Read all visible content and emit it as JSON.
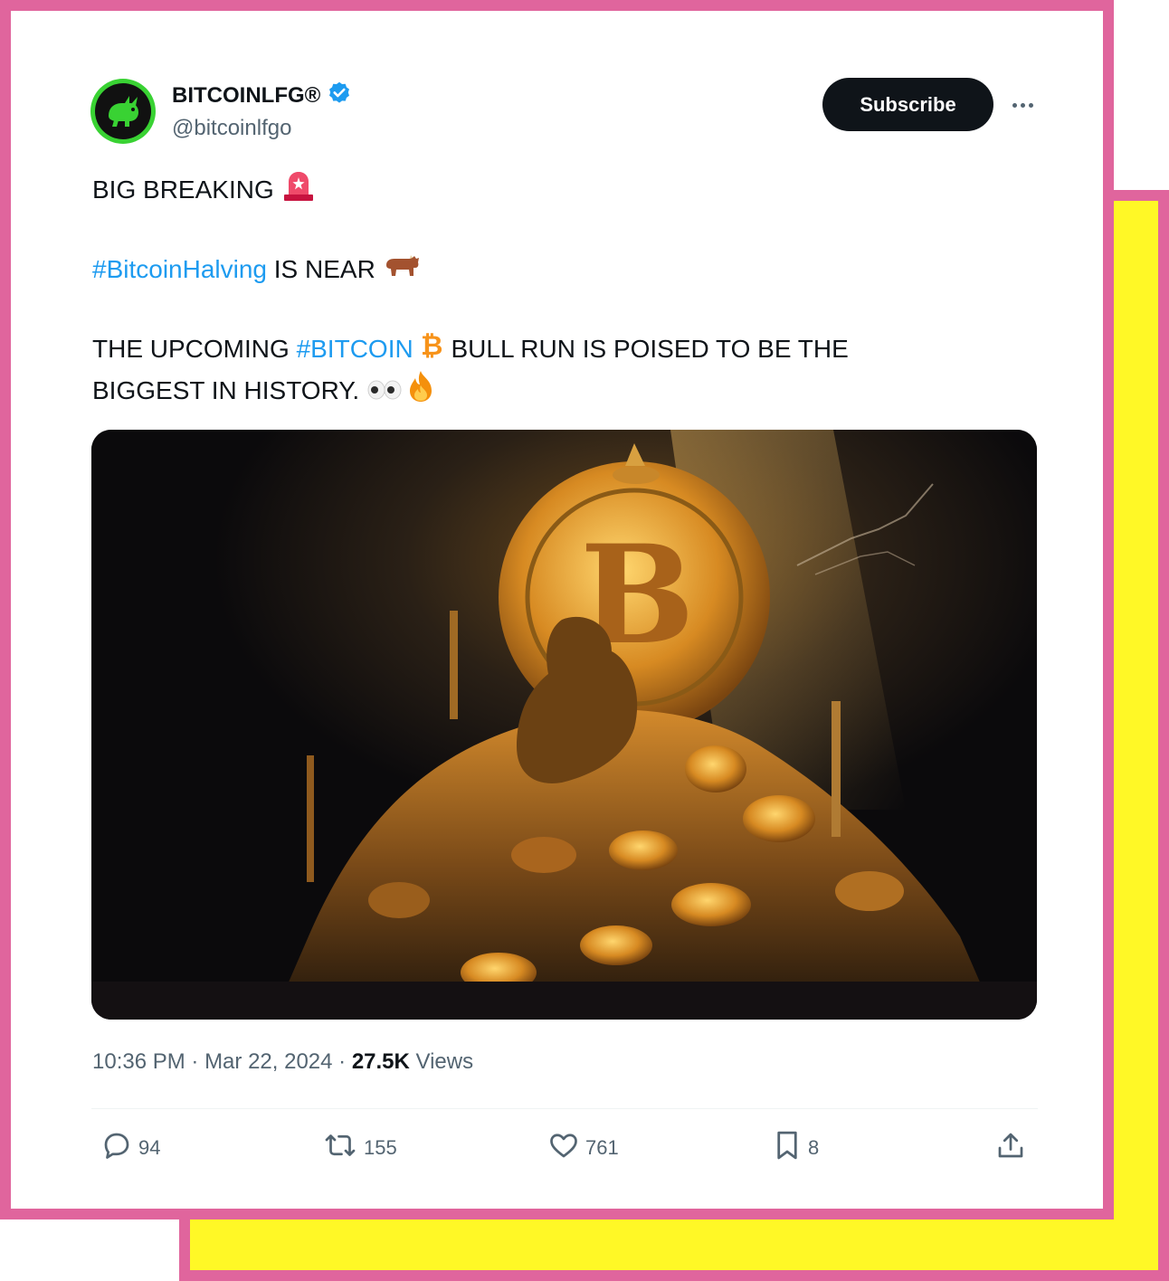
{
  "colors": {
    "frame_pink": "#e0659d",
    "back_yellow": "#fff826",
    "link_blue": "#1d9bf0",
    "verified_blue": "#1d9bf0",
    "avatar_green": "#39d233"
  },
  "author": {
    "display_name": "BITCOINLFG®",
    "handle": "@bitcoinlfgo",
    "verified": true
  },
  "header": {
    "subscribe_label": "Subscribe",
    "more_icon": "more-horizontal-icon"
  },
  "tweet": {
    "line1": {
      "text": "BIG BREAKING",
      "emoji": "rotating-light-emoji"
    },
    "line2": {
      "hashtag": "#BitcoinHalving",
      "text": " IS NEAR",
      "emoji": "bull-emoji"
    },
    "line3": {
      "prefix": "THE UPCOMING ",
      "hashtag": "#BITCOIN",
      "emoji": "bitcoin-emoji",
      "suffix": " BULL RUN IS POISED TO BE THE"
    },
    "line4": {
      "text": "BIGGEST IN HISTORY.",
      "emojis": [
        "eyes-emoji",
        "fire-emoji"
      ]
    },
    "image": {
      "description_icon": "bitcoin-throne-image"
    }
  },
  "meta": {
    "time": "10:36 PM",
    "separator": " · ",
    "date": "Mar 22, 2024",
    "views_count": "27.5K",
    "views_label": " Views"
  },
  "actions": [
    {
      "icon": "reply-icon",
      "count": "94"
    },
    {
      "icon": "retweet-icon",
      "count": "155"
    },
    {
      "icon": "like-icon",
      "count": "761"
    },
    {
      "icon": "bookmark-icon",
      "count": "8"
    },
    {
      "icon": "share-icon",
      "count": ""
    }
  ]
}
